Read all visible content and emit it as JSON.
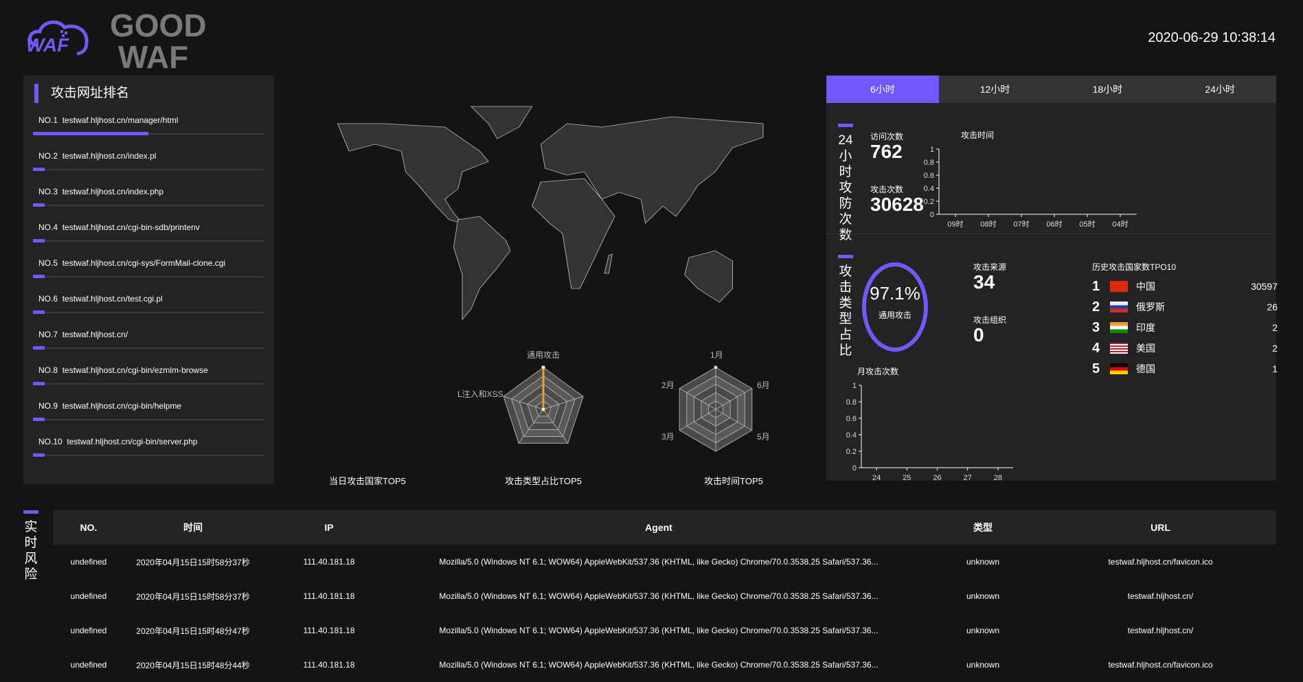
{
  "header": {
    "logo_text": "WAF",
    "brand_line1": "GOOD",
    "brand_line2": "WAF",
    "datetime": "2020-06-29 10:38:14"
  },
  "url_ranking": {
    "title": "攻击网址排名",
    "items": [
      {
        "no": "NO.1",
        "url": "testwaf.hljhost.cn/manager/html",
        "share": 0.5
      },
      {
        "no": "NO.2",
        "url": "testwaf.hljhost.cn/index.pl",
        "share": 0.05
      },
      {
        "no": "NO.3",
        "url": "testwaf.hljhost.cn/index.php",
        "share": 0.05
      },
      {
        "no": "NO.4",
        "url": "testwaf.hljhost.cn/cgi-bin-sdb/printenv",
        "share": 0.05
      },
      {
        "no": "NO.5",
        "url": "testwaf.hljhost.cn/cgi-sys/FormMail-clone.cgi",
        "share": 0.05
      },
      {
        "no": "NO.6",
        "url": "testwaf.hljhost.cn/test.cgi.pl",
        "share": 0.05
      },
      {
        "no": "NO.7",
        "url": "testwaf.hljhost.cn/",
        "share": 0.05
      },
      {
        "no": "NO.8",
        "url": "testwaf.hljhost.cn/cgi-bin/ezmlm-browse",
        "share": 0.05
      },
      {
        "no": "NO.9",
        "url": "testwaf.hljhost.cn/cgi-bin/helpme",
        "share": 0.05
      },
      {
        "no": "NO.10",
        "url": "testwaf.hljhost.cn/cgi-bin/server.php",
        "share": 0.05
      }
    ]
  },
  "center": {
    "map_title": "当日攻击国家TOP5",
    "type_radar": {
      "title": "攻击类型占比TOP5",
      "labels": [
        "通用攻击",
        "L注入和XSS"
      ]
    },
    "time_radar": {
      "title": "攻击时间TOP5",
      "labels": [
        "1月",
        "2月",
        "3月",
        "5月",
        "6月"
      ]
    }
  },
  "tabs": [
    {
      "label": "6小时",
      "active": true
    },
    {
      "label": "12小时"
    },
    {
      "label": "18小时"
    },
    {
      "label": "24小时"
    }
  ],
  "stats": {
    "section_title": "24小时攻防次数",
    "visits_label": "访问次数",
    "visits": "762",
    "attacks_label": "攻击次数",
    "attacks": "30628"
  },
  "chart_data": [
    {
      "type": "line",
      "title": "攻击时间",
      "categories": [
        "09时",
        "08时",
        "07时",
        "06时",
        "05时",
        "04时"
      ],
      "values": [],
      "ylim": [
        0,
        1
      ],
      "yticks": [
        "0",
        "0.2",
        "0.4",
        "0.6",
        "0.8",
        "1"
      ]
    },
    {
      "type": "line",
      "title": "月攻击次数",
      "categories": [
        "24",
        "25",
        "26",
        "27",
        "28"
      ],
      "values": [],
      "ylim": [
        0,
        1
      ],
      "yticks": [
        "0",
        "0.2",
        "0.4",
        "0.6",
        "0.8",
        "1"
      ]
    }
  ],
  "types": {
    "section_title": "攻击类型占比",
    "percent": "97.1%",
    "percent_value": 97.1,
    "percent_label": "通用攻击",
    "source_label": "攻击来源",
    "source": "34",
    "org_label": "攻击组织",
    "org": "0",
    "top_title": "历史攻击国家数TPO10",
    "countries": [
      {
        "rank": "1",
        "name": "中国",
        "count": "30597",
        "flag": "cn"
      },
      {
        "rank": "2",
        "name": "俄罗斯",
        "count": "26",
        "flag": "ru"
      },
      {
        "rank": "3",
        "name": "印度",
        "count": "2",
        "flag": "in"
      },
      {
        "rank": "4",
        "name": "美国",
        "count": "2",
        "flag": "us"
      },
      {
        "rank": "5",
        "name": "德国",
        "count": "1",
        "flag": "de"
      }
    ]
  },
  "realtime": {
    "title": "实时风险",
    "columns": [
      "NO.",
      "时间",
      "IP",
      "Agent",
      "类型",
      "URL"
    ],
    "rows": [
      [
        "undefined",
        "2020年04月15日15时58分37秒",
        "111.40.181.18",
        "Mozilla/5.0 (Windows NT 6.1; WOW64) AppleWebKit/537.36 (KHTML, like Gecko) Chrome/70.0.3538.25 Safari/537.36...",
        "unknown",
        "testwaf.hljhost.cn/favicon.ico"
      ],
      [
        "undefined",
        "2020年04月15日15时58分37秒",
        "111.40.181.18",
        "Mozilla/5.0 (Windows NT 6.1; WOW64) AppleWebKit/537.36 (KHTML, like Gecko) Chrome/70.0.3538.25 Safari/537.36...",
        "unknown",
        "testwaf.hljhost.cn/"
      ],
      [
        "undefined",
        "2020年04月15日15时48分47秒",
        "111.40.181.18",
        "Mozilla/5.0 (Windows NT 6.1; WOW64) AppleWebKit/537.36 (KHTML, like Gecko) Chrome/70.0.3538.25 Safari/537.36...",
        "unknown",
        "testwaf.hljhost.cn/"
      ],
      [
        "undefined",
        "2020年04月15日15时48分44秒",
        "111.40.181.18",
        "Mozilla/5.0 (Windows NT 6.1; WOW64) AppleWebKit/537.36 (KHTML, like Gecko) Chrome/70.0.3538.25 Safari/537.36...",
        "unknown",
        "testwaf.hljhost.cn/favicon.ico"
      ]
    ]
  },
  "colors": {
    "accent": "#7357ff",
    "panel": "#232323",
    "bg": "#141414",
    "radar_line": "#f0a020"
  }
}
